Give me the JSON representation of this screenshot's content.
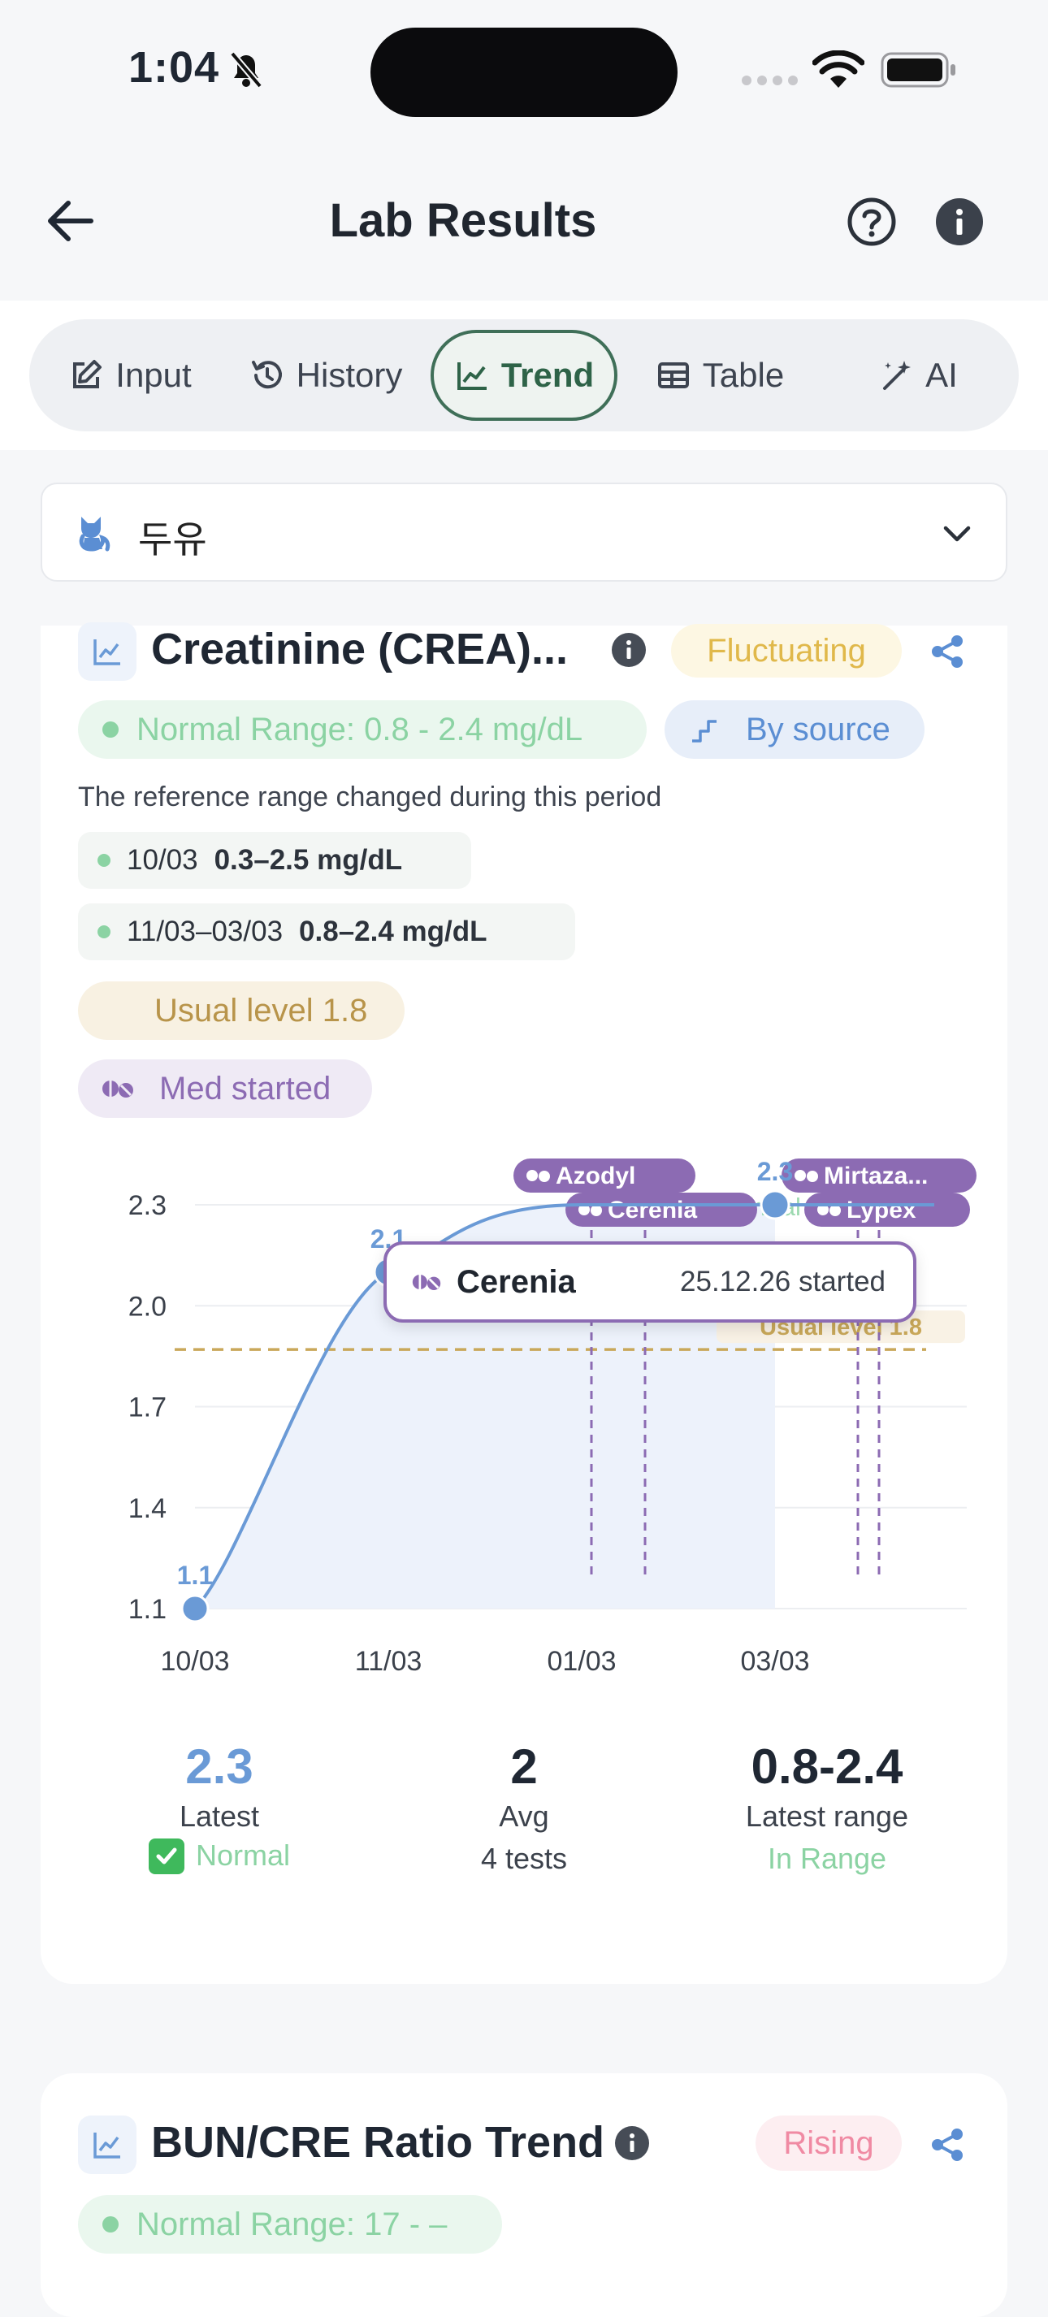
{
  "status_bar": {
    "time": "1:04"
  },
  "nav": {
    "title": "Lab Results"
  },
  "tabs": [
    {
      "label": "Input"
    },
    {
      "label": "History"
    },
    {
      "label": "Trend"
    },
    {
      "label": "Table"
    },
    {
      "label": "AI"
    }
  ],
  "pet": {
    "name": "두유"
  },
  "card1": {
    "title": "Creatinine (CREA)...",
    "trend_badge": "Fluctuating",
    "normal_range": "Normal Range: 0.8 - 2.4 mg/dL",
    "by_source": "By source",
    "note": "The reference range changed during this period",
    "ranges": [
      {
        "period": "10/03",
        "value": "0.3–2.5 mg/dL"
      },
      {
        "period": "11/03–03/03",
        "value": "0.8–2.4 mg/dL"
      }
    ],
    "usual_level": "Usual level 1.8",
    "med_started": "Med started",
    "tooltip": {
      "med": "Cerenia",
      "detail": "25.12.26 started"
    },
    "stats": {
      "latest_value": "2.3",
      "latest_label": "Latest",
      "latest_status": "Normal",
      "avg_value": "2",
      "avg_label": "Avg",
      "avg_count": "4 tests",
      "range_value": "0.8-2.4",
      "range_label": "Latest range",
      "range_status": "In Range"
    }
  },
  "chart_data": {
    "type": "area",
    "x": [
      "10/03",
      "11/03",
      "01/03",
      "03/03"
    ],
    "values": [
      1.1,
      2.1,
      2.3,
      2.3
    ],
    "point_labels": [
      "1.1",
      "2.1",
      "",
      "2.3"
    ],
    "yticks": [
      "2.3",
      "2.0",
      "1.7",
      "1.4",
      "1.1"
    ],
    "ylim": [
      1.1,
      2.35
    ],
    "reference_lines": [
      {
        "label": "Usual level 1.8",
        "value": 1.87
      },
      {
        "label": "Normal Range",
        "value": 2.4
      }
    ],
    "medication_markers": [
      "Azodyl",
      "Cerenia",
      "Mirtaza...",
      "Lypex"
    ],
    "grid": true,
    "colors": {
      "line": "#6a9ad6",
      "fill": "#edf2fb",
      "usual": "#c9a85a",
      "med": "#8c6bb3"
    }
  },
  "card2": {
    "title": "BUN/CRE Ratio Trend",
    "trend_badge": "Rising",
    "normal_range": "Normal Range: 17 - –"
  }
}
